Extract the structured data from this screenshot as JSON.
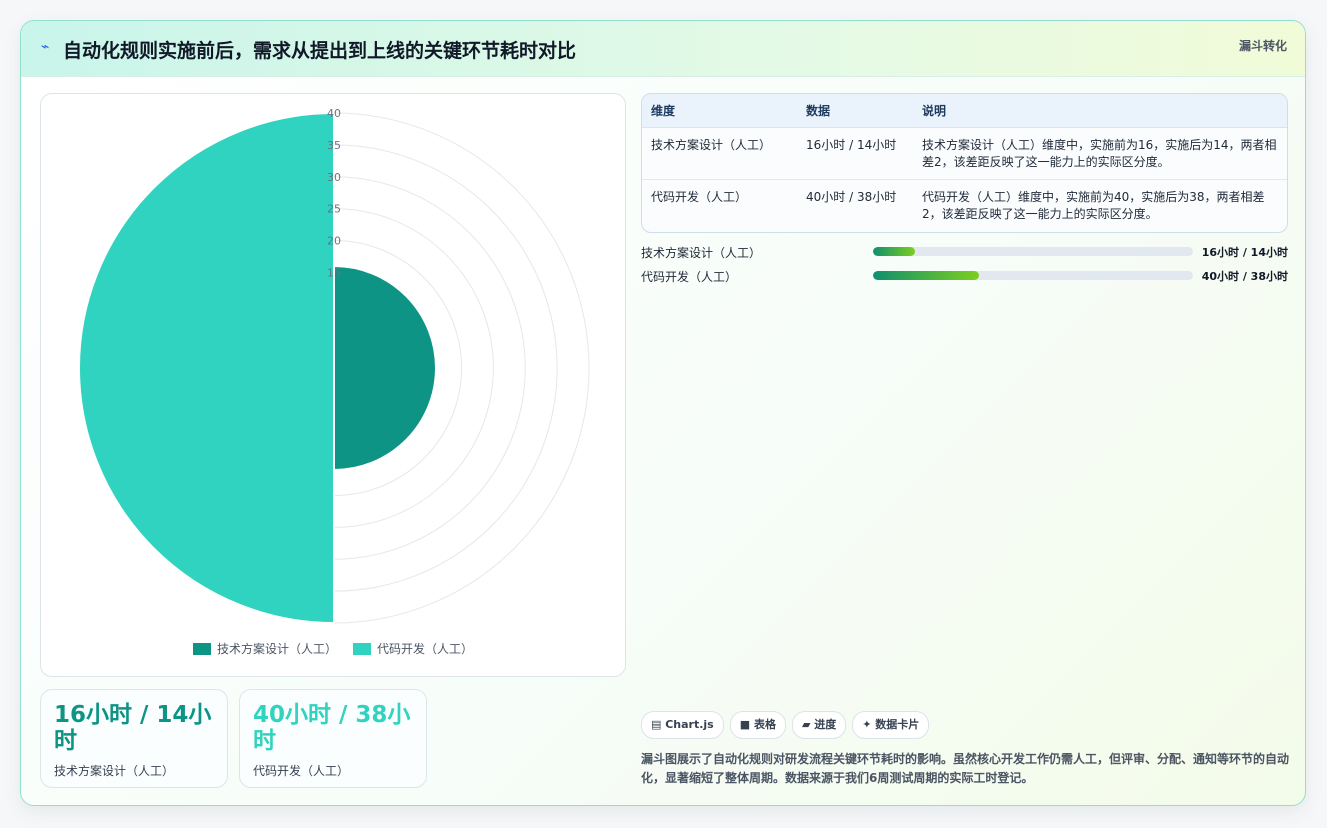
{
  "header": {
    "icon": "lightning-icon",
    "title": "自动化规则实施前后，需求从提出到上线的关键环节耗时对比",
    "tag": "漏斗转化"
  },
  "colors": {
    "series_dark": "#0e9485",
    "series_light": "#2fd3bf"
  },
  "chart_data": {
    "type": "polarArea",
    "categories": [
      "技术方案设计（人工）",
      "代码开发（人工）"
    ],
    "values": [
      16,
      40
    ],
    "colors": [
      "#0e9485",
      "#2fd3bf"
    ],
    "rlim": [
      0,
      40
    ],
    "ticks": [
      "40",
      "35",
      "30",
      "25",
      "20",
      "15"
    ],
    "legend": [
      "技术方案设计（人工）",
      "代码开发（人工）"
    ],
    "legend_position": "bottom"
  },
  "kpis": [
    {
      "value": "16小时 / 14小时",
      "label": "技术方案设计（人工）"
    },
    {
      "value": "40小时 / 38小时",
      "label": "代码开发（人工）"
    }
  ],
  "table": {
    "headers": [
      "维度",
      "数据",
      "说明"
    ],
    "rows": [
      {
        "dim": "技术方案设计（人工）",
        "data": "16小时 / 14小时",
        "desc": "技术方案设计（人工）维度中，实施前为16，实施后为14，两者相差2，该差距反映了这一能力上的实际区分度。"
      },
      {
        "dim": "代码开发（人工）",
        "data": "40小时 / 38小时",
        "desc": "代码开发（人工）维度中，实施前为40，实施后为38，两者相差2，该差距反映了这一能力上的实际区分度。"
      }
    ]
  },
  "bars": [
    {
      "label": "技术方案设计（人工）",
      "value": "16小时 / 14小时",
      "fill_fraction": 0.13
    },
    {
      "label": "代码开发（人工）",
      "value": "40小时 / 38小时",
      "fill_fraction": 0.33
    }
  ],
  "chips": [
    {
      "icon": "chart-icon",
      "label": "▤ Chart.js"
    },
    {
      "icon": "table-icon",
      "label": "■ 表格"
    },
    {
      "icon": "progress-icon",
      "label": "▰ 进度"
    },
    {
      "icon": "card-icon",
      "label": "✦ 数据卡片"
    }
  ],
  "note": "漏斗图展示了自动化规则对研发流程关键环节耗时的影响。虽然核心开发工作仍需人工，但评审、分配、通知等环节的自动化，显著缩短了整体周期。数据来源于我们6周测试周期的实际工时登记。"
}
